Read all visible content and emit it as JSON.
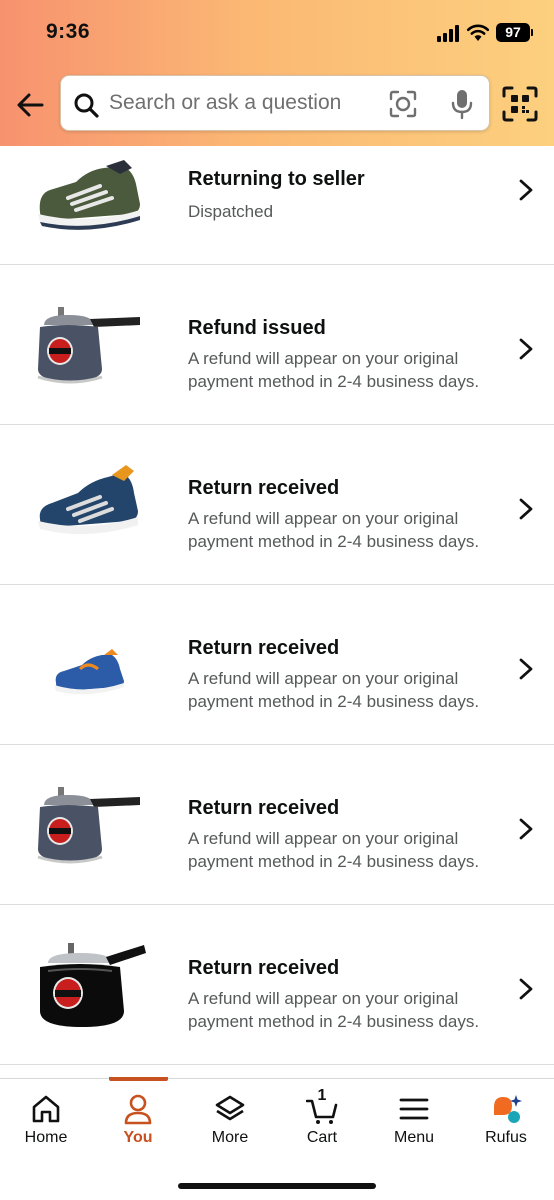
{
  "status_bar": {
    "time": "9:36",
    "battery": "97"
  },
  "search": {
    "placeholder": "Search or ask a question"
  },
  "orders": [
    {
      "title": "Returning to seller",
      "subtitle": "Dispatched",
      "image": "grey-sneaker"
    },
    {
      "title": "Refund issued",
      "subtitle": "A refund will appear on your original payment method in 2-4 business days.",
      "image": "grey-pressure-cooker"
    },
    {
      "title": "Return received",
      "subtitle": "A refund will appear on your original payment method in 2-4 business days.",
      "image": "navy-sneaker"
    },
    {
      "title": "Return received",
      "subtitle": "A refund will appear on your original payment method in 2-4 business days.",
      "image": "blue-sneaker"
    },
    {
      "title": "Return received",
      "subtitle": "A refund will appear on your original payment method in 2-4 business days.",
      "image": "grey-pressure-cooker"
    },
    {
      "title": "Return received",
      "subtitle": "A refund will appear on your original payment method in 2-4 business days.",
      "image": "black-pressure-cooker"
    }
  ],
  "bottom_nav": {
    "home": "Home",
    "you": "You",
    "more": "More",
    "cart": "Cart",
    "cart_count": "1",
    "menu": "Menu",
    "rufus": "Rufus",
    "active": "you"
  },
  "colors": {
    "accent": "#c7511f",
    "header_gradient": [
      "#f7926f",
      "#fcd07e"
    ]
  }
}
